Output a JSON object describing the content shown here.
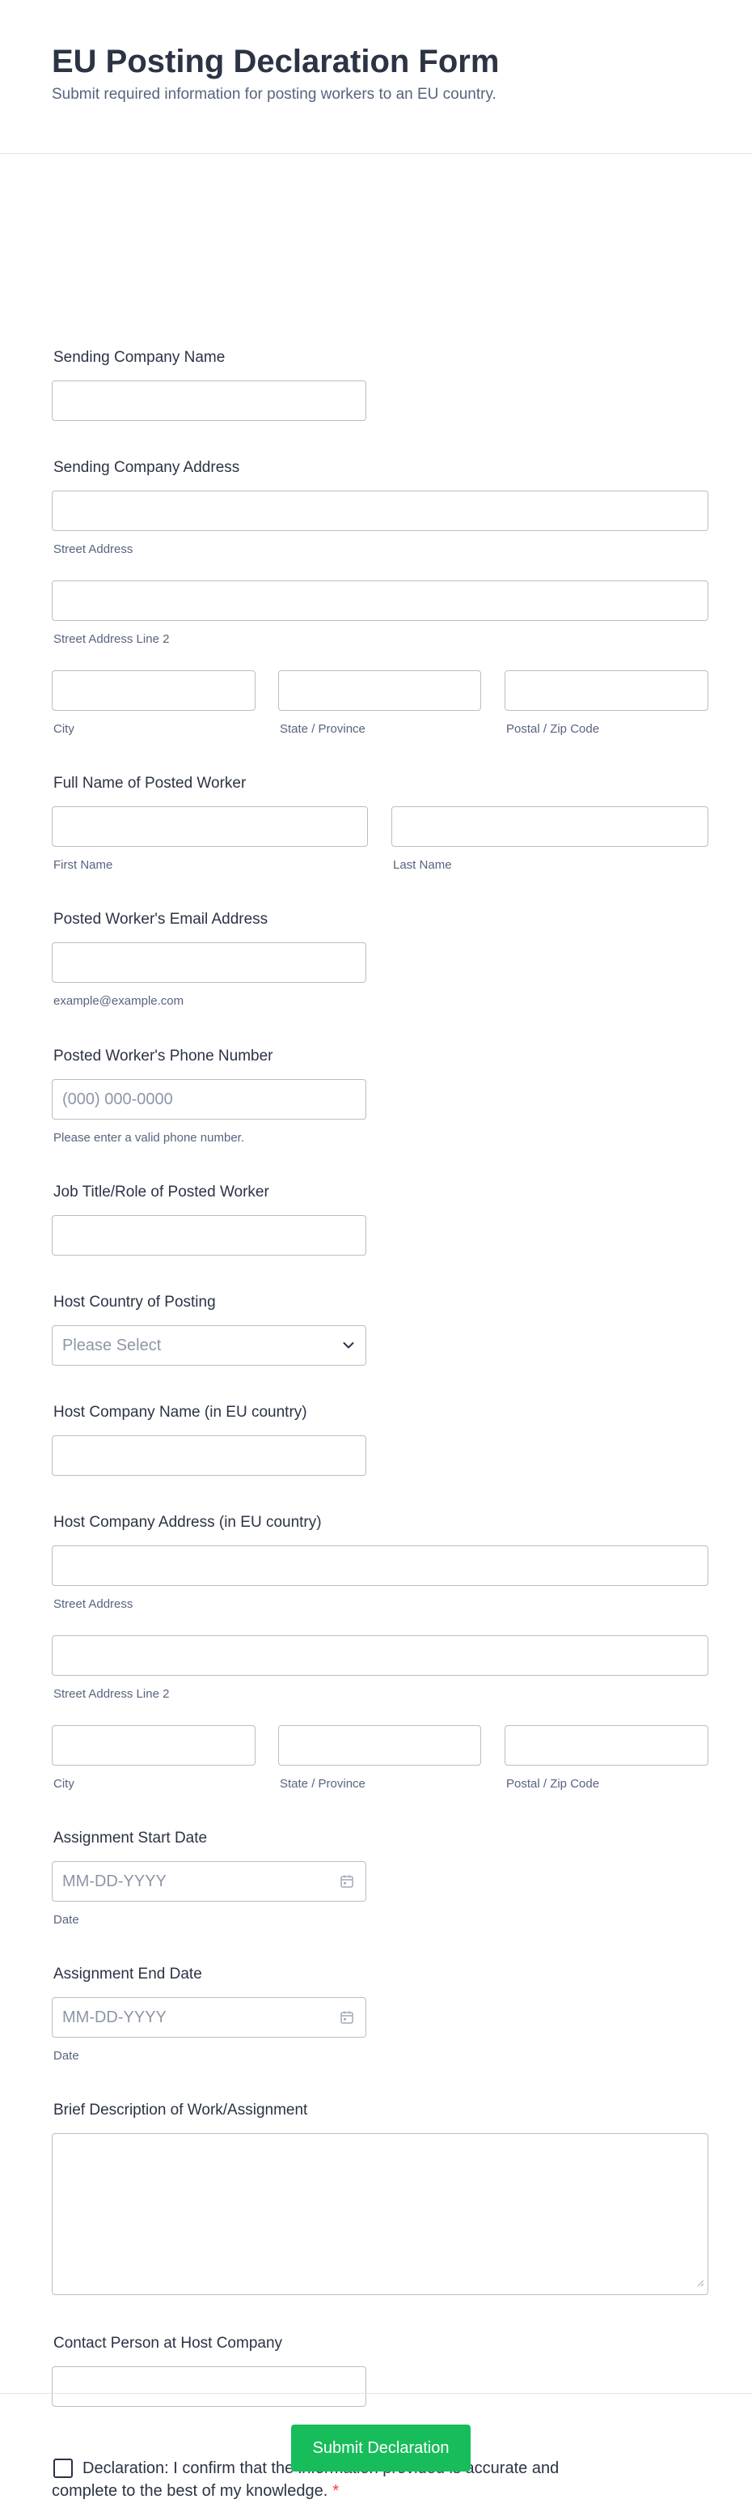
{
  "header": {
    "title": "EU Posting Declaration Form",
    "subtitle": "Submit required information for posting workers to an EU country."
  },
  "fields": {
    "sending_company_name": {
      "label": "Sending Company Name"
    },
    "sending_company_address": {
      "label": "Sending Company Address",
      "street": "Street Address",
      "street2": "Street Address Line 2",
      "city": "City",
      "state": "State / Province",
      "zip": "Postal / Zip Code"
    },
    "worker_name": {
      "label": "Full Name of Posted Worker",
      "first": "First Name",
      "last": "Last Name"
    },
    "worker_email": {
      "label": "Posted Worker's Email Address",
      "sublabel": "example@example.com"
    },
    "worker_phone": {
      "label": "Posted Worker's Phone Number",
      "placeholder": "(000) 000-0000",
      "sublabel": "Please enter a valid phone number."
    },
    "job_title": {
      "label": "Job Title/Role of Posted Worker"
    },
    "host_country": {
      "label": "Host Country of Posting",
      "selected": "Please Select"
    },
    "host_company_name": {
      "label": "Host Company Name (in EU country)"
    },
    "host_company_address": {
      "label": "Host Company Address (in EU country)",
      "street": "Street Address",
      "street2": "Street Address Line 2",
      "city": "City",
      "state": "State / Province",
      "zip": "Postal / Zip Code"
    },
    "start_date": {
      "label": "Assignment Start Date",
      "placeholder": "MM-DD-YYYY",
      "sublabel": "Date"
    },
    "end_date": {
      "label": "Assignment End Date",
      "placeholder": "MM-DD-YYYY",
      "sublabel": "Date"
    },
    "description": {
      "label": "Brief Description of Work/Assignment"
    },
    "contact_person": {
      "label": "Contact Person at Host Company"
    },
    "declaration": {
      "text": "Declaration: I confirm that the information provided is accurate and complete to the best of my knowledge.",
      "required_mark": "*"
    }
  },
  "submit": {
    "label": "Submit Declaration"
  },
  "icons": {
    "select": "chevron-down-icon",
    "date": "calendar-icon",
    "textarea": "resize-handle-icon"
  },
  "colors": {
    "accent": "#18bd5b",
    "required": "#f23a3c",
    "text": "#2c3345",
    "sublabel": "#57647e",
    "border": "#b8bdc9"
  }
}
